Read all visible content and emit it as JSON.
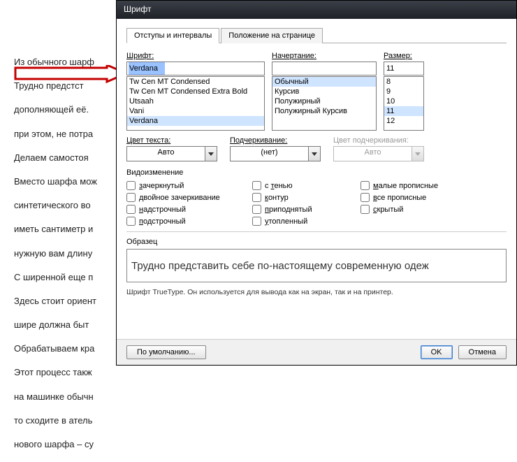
{
  "background_paragraphs": [
    "Из обычного шарф",
    "Трудно предстст",
    "дополняющей её.",
    "при этом, не потра",
    "Делаем самостоя",
    "Вместо шарфа мож",
    "синтетического во",
    "иметь сантиметр и",
    "нужную вам длину",
    " С ширенной еще п",
    "Здесь стоит ориент",
    "шире должна быт",
    "Обрабатываем кра",
    "Этот процесс такж",
    "на машинке обычн",
    "то сходите в атель",
    "нового шарфа – су"
  ],
  "dialog": {
    "title": "Шрифт",
    "tabs": {
      "t1": "Отступы и интервалы",
      "t2": "Положение на странице"
    },
    "font": {
      "label": "Шрифт:",
      "value": "Verdana",
      "items": [
        "Tw Cen MT Condensed",
        "Tw Cen MT Condensed Extra Bold",
        "Utsaah",
        "Vani",
        "Verdana"
      ]
    },
    "style": {
      "label": "Начертание:",
      "value": "",
      "items": [
        "Обычный",
        "Курсив",
        "Полужирный",
        "Полужирный Курсив"
      ]
    },
    "size": {
      "label": "Размер:",
      "value": "11",
      "items": [
        "8",
        "9",
        "10",
        "11",
        "12"
      ]
    },
    "color": {
      "label": "Цвет текста:",
      "value": "Авто"
    },
    "underline": {
      "label": "Подчеркивание:",
      "value": "(нет)"
    },
    "ucolor": {
      "label": "Цвет подчеркивания:",
      "value": "Авто"
    },
    "effects_title": "Видоизменение",
    "effects": {
      "strike": "зачеркнутый",
      "dstrike": "двойное зачеркивание",
      "super": "надстрочный",
      "sub": "подстрочный",
      "shadow": "с тенью",
      "outline": "контур",
      "emboss": "приподнятый",
      "engrave": "утопленный",
      "smallcaps": "малые прописные",
      "allcaps": "все прописные",
      "hidden": "скрытый"
    },
    "ul": {
      "strike": "з",
      "dstrike": "д",
      "super": "н",
      "sub": "п",
      "shadow": "т",
      "outline": "к",
      "emboss": "п",
      "engrave": "у",
      "smallcaps": "м",
      "allcaps": "в",
      "hidden": "с"
    },
    "sample_label": "Образец",
    "sample_text": "Трудно представить себе по-настоящему современную одеж",
    "info": "Шрифт TrueType. Он используется для вывода как на экран, так и на принтер.",
    "buttons": {
      "default": "По умолчанию...",
      "ok": "OK",
      "cancel": "Отмена"
    }
  }
}
